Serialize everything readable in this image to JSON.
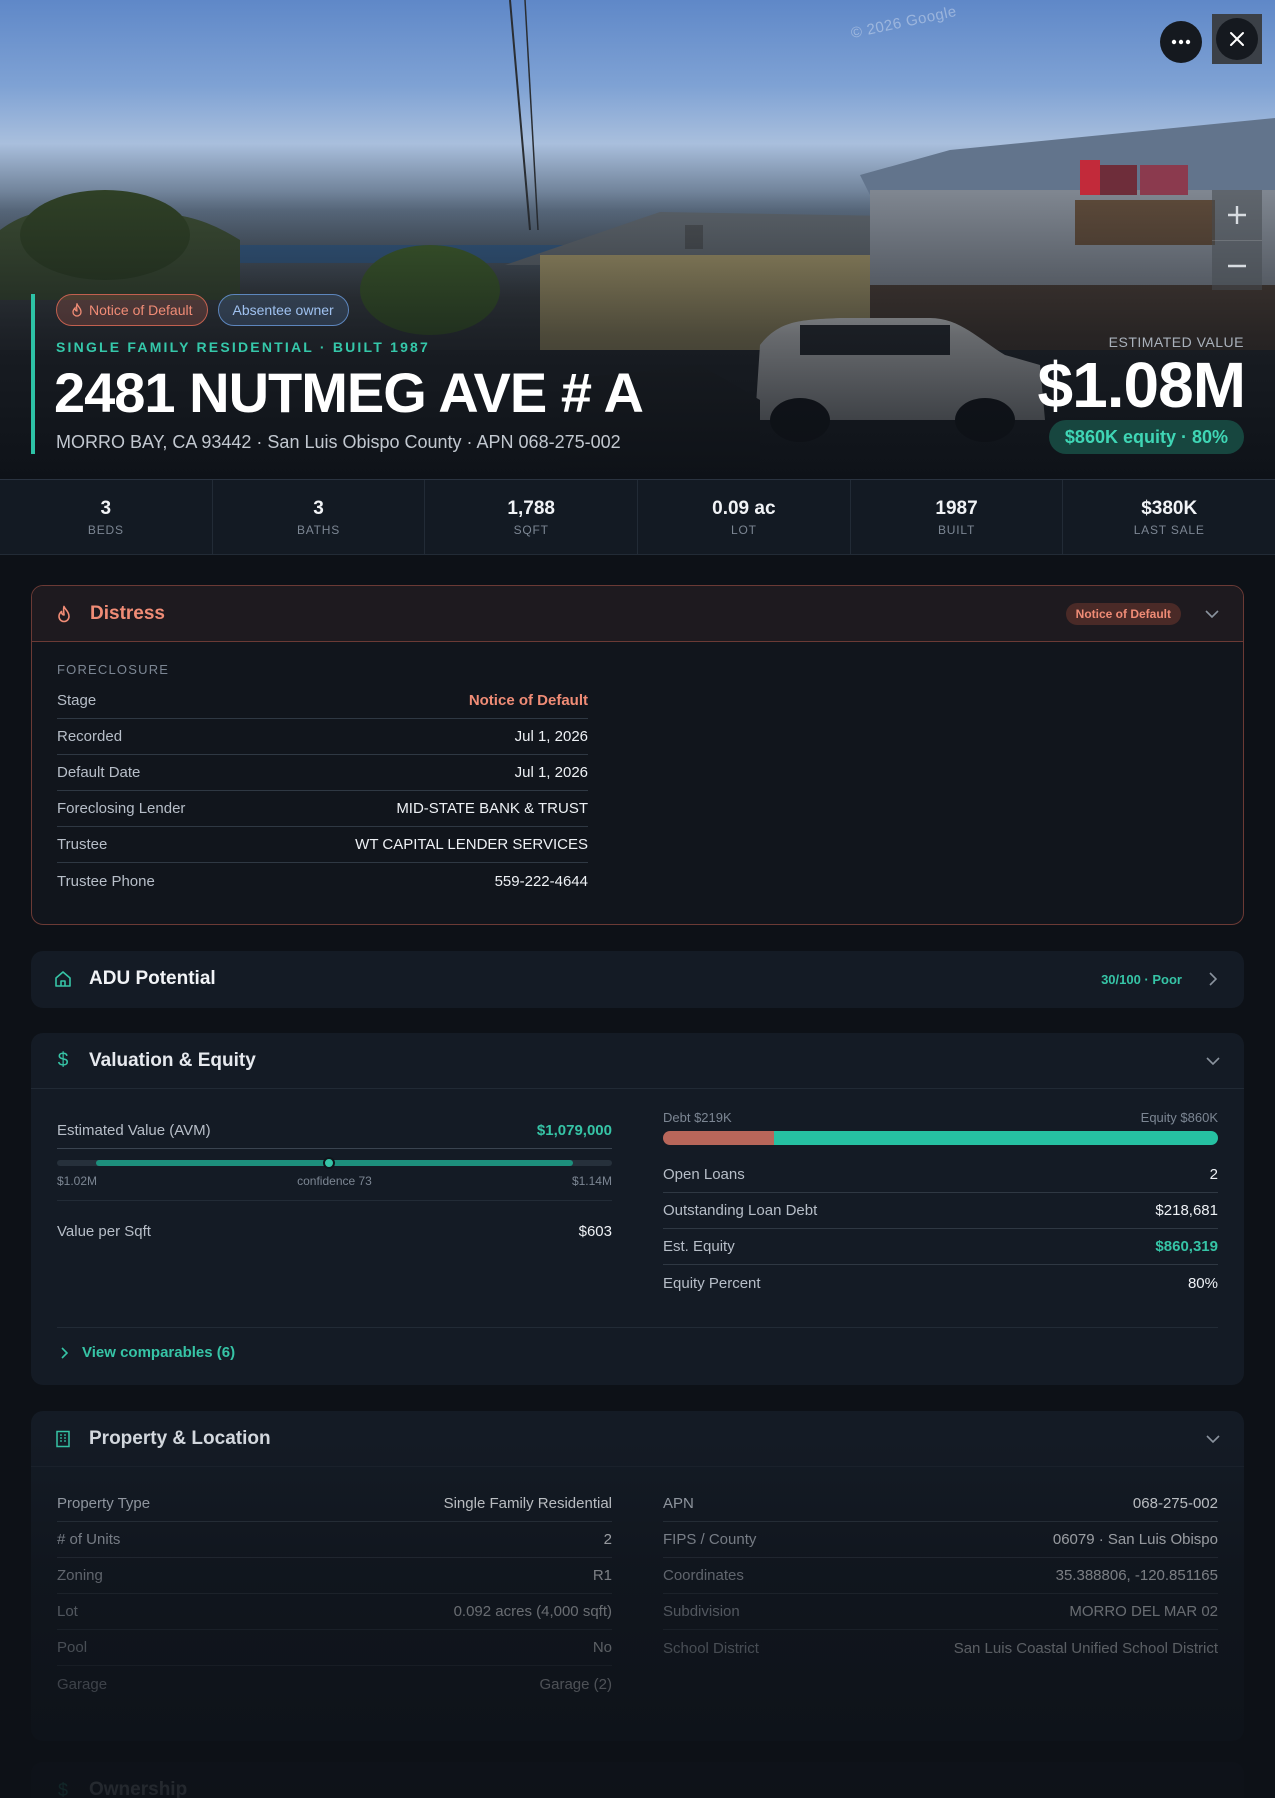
{
  "hero": {
    "watermark": "© 2026 Google",
    "badges": [
      {
        "label": "Notice of Default",
        "icon": "flame-icon"
      },
      {
        "label": "Absentee owner"
      }
    ],
    "subtitle": "SINGLE FAMILY RESIDENTIAL · BUILT 1987",
    "address": "2481 NUTMEG AVE # A",
    "location_line": "MORRO BAY, CA 93442 · San Luis Obispo County · APN 068-275-002",
    "estimated_value_label": "ESTIMATED VALUE",
    "estimated_value": "$1.08M",
    "equity_pill": "$860K equity · 80%"
  },
  "stats": [
    {
      "value": "3",
      "label": "BEDS"
    },
    {
      "value": "3",
      "label": "BATHS"
    },
    {
      "value": "1,788",
      "label": "SQFT"
    },
    {
      "value": "0.09 ac",
      "label": "LOT"
    },
    {
      "value": "1987",
      "label": "BUILT"
    },
    {
      "value": "$380K",
      "label": "LAST SALE"
    }
  ],
  "distress": {
    "title": "Distress",
    "tag": "Notice of Default",
    "section_label": "FORECLOSURE",
    "rows": [
      {
        "key": "Stage",
        "value": "Notice of Default"
      },
      {
        "key": "Recorded",
        "value": "Jul 1, 2026"
      },
      {
        "key": "Default Date",
        "value": "Jul 1, 2026"
      },
      {
        "key": "Foreclosing Lender",
        "value": "MID-STATE BANK & TRUST"
      },
      {
        "key": "Trustee",
        "value": "WT CAPITAL LENDER SERVICES"
      },
      {
        "key": "Trustee Phone",
        "value": "559-222-4644"
      }
    ]
  },
  "adu": {
    "title": "ADU Potential",
    "tag": "30/100 · Poor"
  },
  "valuation": {
    "title": "Valuation & Equity",
    "avm_label": "Estimated Value (AVM)",
    "avm_value": "$1,079,000",
    "range_low": "$1.02M",
    "range_high": "$1.14M",
    "confidence_label": "confidence 73",
    "confidence": 73,
    "value_per_sqft_label": "Value per Sqft",
    "value_per_sqft": "$603",
    "debt_label": "Debt $219K",
    "equity_label": "Equity $860K",
    "debt_fraction": 0.2,
    "rows": [
      {
        "key": "Open Loans",
        "value": "2"
      },
      {
        "key": "Outstanding Loan Debt",
        "value": "$218,681"
      },
      {
        "key": "Est. Equity",
        "value": "$860,319"
      },
      {
        "key": "Equity Percent",
        "value": "80%"
      }
    ],
    "comparables_link": "View comparables (6)"
  },
  "property": {
    "title": "Property & Location",
    "left_rows": [
      {
        "key": "Property Type",
        "value": "Single Family Residential"
      },
      {
        "key": "# of Units",
        "value": "2"
      },
      {
        "key": "Zoning",
        "value": "R1"
      },
      {
        "key": "Lot",
        "value": "0.092 acres (4,000 sqft)"
      },
      {
        "key": "Pool",
        "value": "No"
      },
      {
        "key": "Garage",
        "value": "Garage (2)"
      }
    ],
    "right_rows": [
      {
        "key": "APN",
        "value": "068-275-002"
      },
      {
        "key": "FIPS / County",
        "value": "06079 · San Luis Obispo"
      },
      {
        "key": "Coordinates",
        "value": "35.388806, -120.851165"
      },
      {
        "key": "Subdivision",
        "value": "MORRO DEL MAR 02"
      },
      {
        "key": "School District",
        "value": "San Luis Coastal Unified School District"
      }
    ]
  },
  "ownership": {
    "title": "Ownership"
  },
  "colors": {
    "accent": "#2dc2a6",
    "distress": "#f08c76",
    "background": "#0d1117"
  }
}
